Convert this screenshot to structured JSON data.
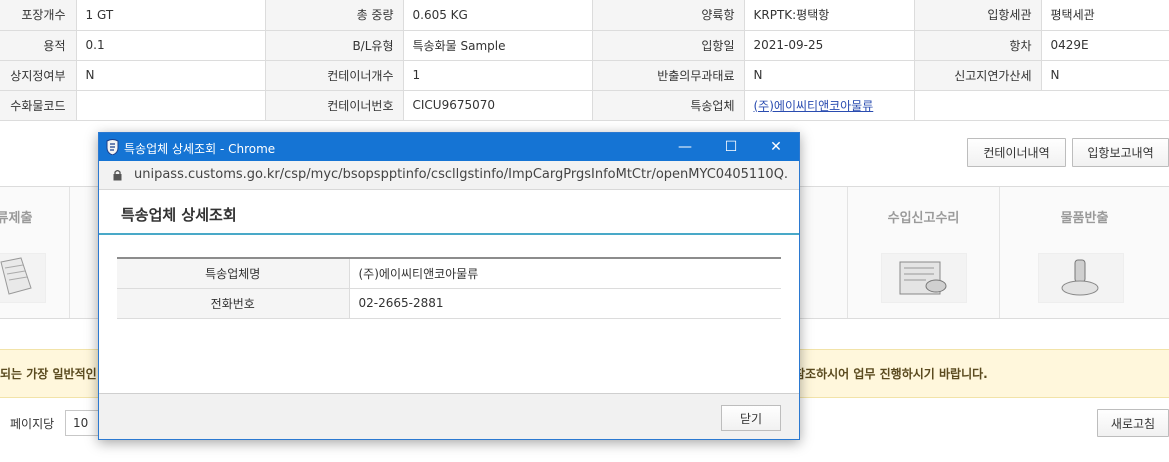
{
  "info_rows": [
    [
      {
        "label": "포장개수",
        "value": "1 GT"
      },
      {
        "label": "총 중량",
        "value": "0.605 KG"
      },
      {
        "label": "양륙항",
        "value": "KRPTK:평택항"
      },
      {
        "label": "입항세관",
        "value": "평택세관"
      }
    ],
    [
      {
        "label": "용적",
        "value": "0.1"
      },
      {
        "label": "B/L유형",
        "value": "특송화물 Sample"
      },
      {
        "label": "입항일",
        "value": "2021-09-25"
      },
      {
        "label": "항차",
        "value": "0429E"
      }
    ],
    [
      {
        "label": "상지정여부",
        "value": "N"
      },
      {
        "label": "컨테이너개수",
        "value": "1"
      },
      {
        "label": "반출의무과태료",
        "value": "N"
      },
      {
        "label": "신고지연가산세",
        "value": "N"
      }
    ],
    [
      {
        "label": "수화물코드",
        "value": ""
      },
      {
        "label": "컨테이너번호",
        "value": "CICU9675070"
      },
      {
        "label": "특송업체",
        "value": "(주)에이씨티앤코아물류"
      },
      {
        "label": "",
        "value": ""
      }
    ]
  ],
  "buttons": {
    "container_list": "컨테이너내역",
    "arrival_report": "입항보고내역",
    "refresh": "새로고침"
  },
  "steps": {
    "left_partial": "류제출",
    "import_accept": "수입신고수리",
    "goods_release": "물품반출"
  },
  "notice": {
    "left": "되는 가장 일반적인",
    "right": "참조하시어 업무 진행하시기 바랍니다."
  },
  "pager": {
    "label": "페이지당",
    "value": "10"
  },
  "popup": {
    "window_title": "특송업체 상세조회 - Chrome",
    "url": "unipass.customs.go.kr/csp/myc/bsopspptinfo/cscllgstinfo/ImpCargPrgsInfoMtCtr/openMYC0405110Q...",
    "heading": "특송업체 상세조회",
    "rows": [
      {
        "label": "특송업체명",
        "value": "(주)에이씨티앤코아물류"
      },
      {
        "label": "전화번호",
        "value": "02-2665-2881"
      }
    ],
    "close_label": "닫기",
    "minimize_glyph": "—",
    "maximize_glyph": "☐",
    "close_glyph": "✕"
  },
  "colors": {
    "titlebar": "#1574d4",
    "header_accent": "#49a9c8",
    "notice_bg": "#fff7dc",
    "link": "#2a4cb0"
  }
}
